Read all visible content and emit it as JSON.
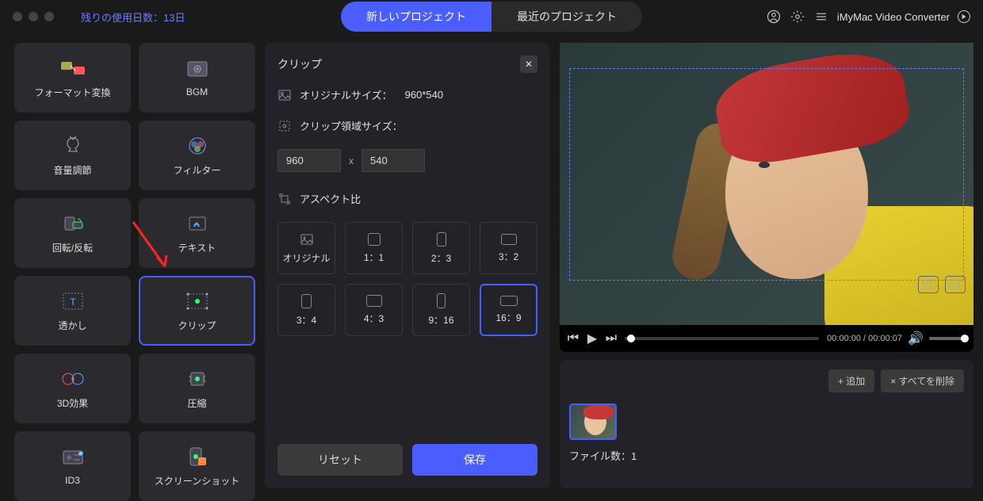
{
  "topbar": {
    "trial_text": "残りの使用日数：13日",
    "tab_new": "新しいプロジェクト",
    "tab_recent": "最近のプロジェクト",
    "app_name": "iMyMac Video Converter"
  },
  "tools": [
    {
      "label": "フォーマット変換",
      "icon": "convert-icon"
    },
    {
      "label": "BGM",
      "icon": "bgm-icon"
    },
    {
      "label": "音量調節",
      "icon": "volume-icon"
    },
    {
      "label": "フィルター",
      "icon": "filter-icon"
    },
    {
      "label": "回転/反転",
      "icon": "rotate-icon"
    },
    {
      "label": "テキスト",
      "icon": "text-icon"
    },
    {
      "label": "透かし",
      "icon": "watermark-icon"
    },
    {
      "label": "クリップ",
      "icon": "clip-icon"
    },
    {
      "label": "3D効果",
      "icon": "3d-icon"
    },
    {
      "label": "圧縮",
      "icon": "compress-icon"
    },
    {
      "label": "ID3",
      "icon": "id3-icon"
    },
    {
      "label": "スクリーンショット",
      "icon": "screenshot-icon"
    }
  ],
  "panel": {
    "title": "クリップ",
    "original_label": "オリジナルサイズ：",
    "original_size": "960*540",
    "crop_label": "クリップ領域サイズ：",
    "width_value": "960",
    "height_value": "540",
    "x_label": "x",
    "aspect_label": "アスペクト比",
    "ratios": [
      "オリジナル",
      "1：1",
      "2：3",
      "3：2",
      "3：4",
      "4：3",
      "9：16",
      "16：9"
    ],
    "reset": "リセット",
    "save": "保存"
  },
  "preview": {
    "time_current": "00:00:00",
    "time_total": "00:00:07"
  },
  "files": {
    "add": "+ 追加",
    "clear": "× すべてを削除",
    "count_label": "ファイル数：1"
  }
}
